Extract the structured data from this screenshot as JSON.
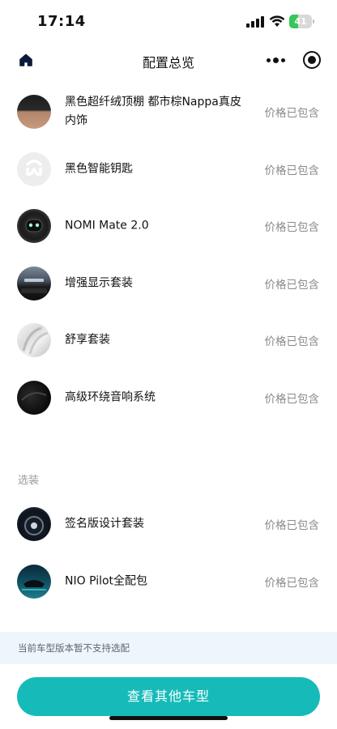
{
  "status_bar": {
    "time": "17:14",
    "battery_level": "41",
    "battery_fraction": 0.41,
    "signal_bars": 4
  },
  "nav": {
    "title": "配置总览",
    "home_icon": "home-icon",
    "more_icon": "more-dots-icon",
    "close_icon": "target-icon"
  },
  "included": [
    {
      "title": "黑色超纤绒顶棚 都市棕Nappa真皮内饰",
      "price": "价格已包含",
      "thumb": "interior-brown-thumb"
    },
    {
      "title": "黑色智能钥匙",
      "price": "价格已包含",
      "thumb": "nio-logo-thumb"
    },
    {
      "title": "NOMI Mate 2.0",
      "price": "价格已包含",
      "thumb": "nomi-thumb"
    },
    {
      "title": "增强显示套装",
      "price": "价格已包含",
      "thumb": "display-thumb"
    },
    {
      "title": "舒享套装",
      "price": "价格已包含",
      "thumb": "seat-thumb"
    },
    {
      "title": "高级环绕音响系统",
      "price": "价格已包含",
      "thumb": "audio-thumb"
    }
  ],
  "optional_label": "选装",
  "optional": [
    {
      "title": "签名版设计套装",
      "price": "价格已包含",
      "thumb": "wheel-thumb"
    },
    {
      "title": "NIO Pilot全配包",
      "price": "价格已包含",
      "thumb": "pilot-thumb"
    }
  ],
  "notice": "当前车型版本暂不支持选配",
  "cta_label": "查看其他车型",
  "colors": {
    "accent": "#16bbb9",
    "notice_bg": "#eef5fb",
    "muted": "#8a8a8a"
  }
}
